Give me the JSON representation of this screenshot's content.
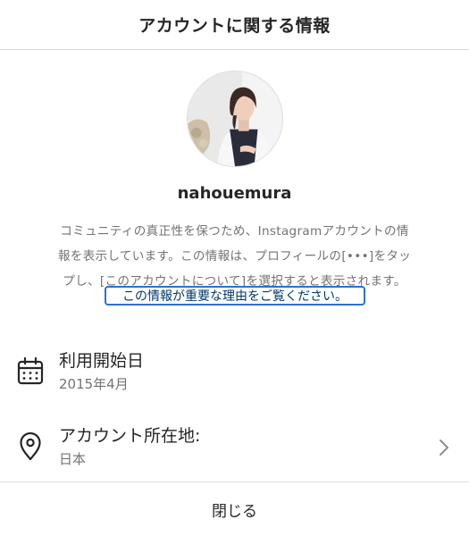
{
  "dialog": {
    "title": "アカウントに関する情報",
    "close_label": "閉じる"
  },
  "profile": {
    "username": "nahouemura",
    "description_lines": [
      "コミュニティの真正性を保つため、Instagramアカウントの情",
      "報を表示しています。この情報は、プロフィールの[•••]をタッ",
      "プし、[このアカウントについて]を選択すると表示されます。"
    ],
    "learn_more_link": "この情報が重要な理由をご覧ください。"
  },
  "details": {
    "joined": {
      "icon": "calendar-icon",
      "label": "利用開始日",
      "value": "2015年4月"
    },
    "location": {
      "icon": "location-pin-icon",
      "label": "アカウント所在地:",
      "value": "日本"
    }
  },
  "colors": {
    "text_primary": "#262626",
    "text_secondary": "#737373",
    "link": "#00376b",
    "focus_ring": "#2f6fd6",
    "divider": "#dbdbdb"
  }
}
